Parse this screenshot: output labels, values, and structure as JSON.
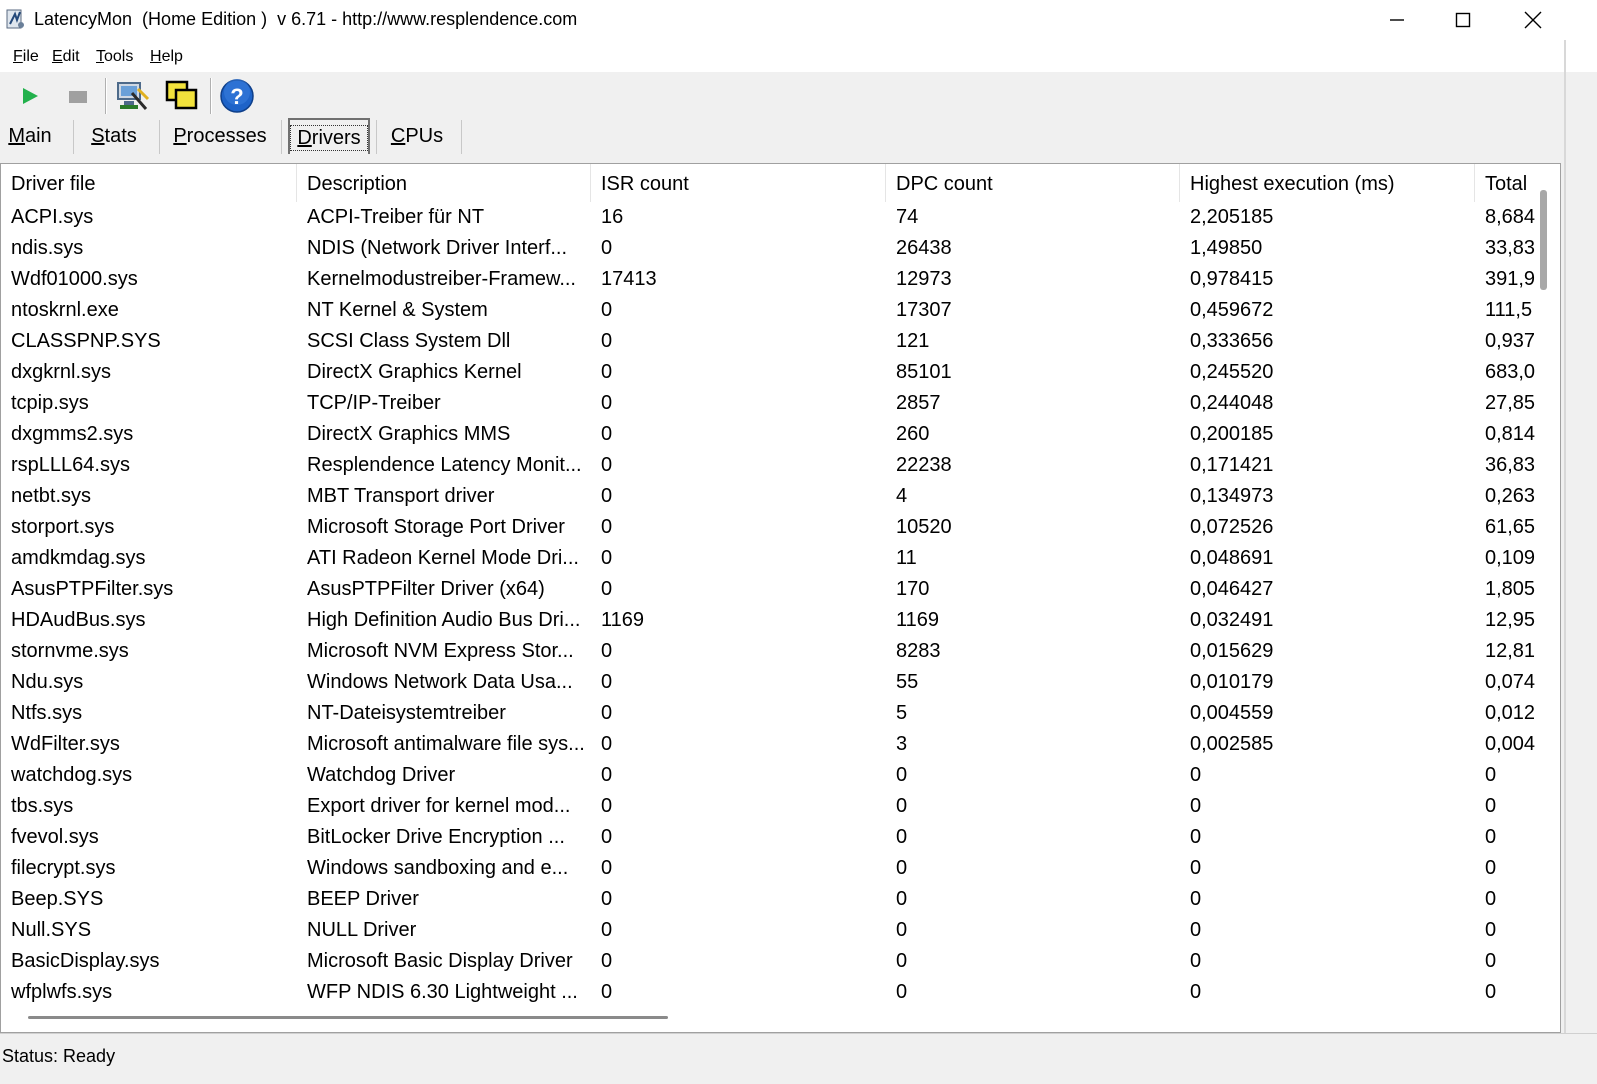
{
  "window": {
    "title": "LatencyMon  (Home Edition )  v 6.71 - http://www.resplendence.com",
    "controls": [
      "minimize-button",
      "maximize-button",
      "close-button"
    ]
  },
  "menu": [
    {
      "label": "File",
      "ul": "F",
      "rest": "ile"
    },
    {
      "label": "Edit",
      "ul": "E",
      "rest": "dit"
    },
    {
      "label": "Tools",
      "ul": "T",
      "rest": "ools"
    },
    {
      "label": "Help",
      "ul": "H",
      "rest": "elp"
    }
  ],
  "toolbar": {
    "buttons": [
      {
        "name": "start-monitoring-button",
        "icon": "play-icon",
        "color": "#22b14c"
      },
      {
        "name": "stop-monitoring-button",
        "icon": "stop-icon",
        "color": "#a0a0a0"
      },
      {
        "name": "system-info-button",
        "icon": "monitor-tools-icon"
      },
      {
        "name": "windows-button",
        "icon": "windows-icon"
      },
      {
        "name": "help-button",
        "icon": "help-icon",
        "color": "#1e63c8"
      }
    ]
  },
  "tabs": [
    {
      "label": "Main",
      "ul": "M",
      "rest": "ain",
      "active": false
    },
    {
      "label": "Stats",
      "ul": "S",
      "rest": "tats",
      "active": false
    },
    {
      "label": "Processes",
      "ul": "P",
      "rest": "rocesses",
      "active": false
    },
    {
      "label": "Drivers",
      "ul": "D",
      "rest": "rivers",
      "active": true
    },
    {
      "label": "CPUs",
      "ul": "C",
      "rest": "PUs",
      "active": false
    }
  ],
  "table": {
    "columns": [
      "Driver file",
      "Description",
      "ISR count",
      "DPC count",
      "Highest execution (ms)",
      "Total"
    ],
    "rows": [
      [
        "ACPI.sys",
        "ACPI-Treiber für NT",
        "16",
        "74",
        "2,205185",
        "8,684"
      ],
      [
        "ndis.sys",
        "NDIS (Network Driver Interf...",
        "0",
        "26438",
        "1,49850",
        "33,83"
      ],
      [
        "Wdf01000.sys",
        "Kernelmodustreiber-Framew...",
        "17413",
        "12973",
        "0,978415",
        "391,9"
      ],
      [
        "ntoskrnl.exe",
        "NT Kernel & System",
        "0",
        "17307",
        "0,459672",
        "111,5"
      ],
      [
        "CLASSPNP.SYS",
        "SCSI Class System Dll",
        "0",
        "121",
        "0,333656",
        "0,937"
      ],
      [
        "dxgkrnl.sys",
        "DirectX Graphics Kernel",
        "0",
        "85101",
        "0,245520",
        "683,0"
      ],
      [
        "tcpip.sys",
        "TCP/IP-Treiber",
        "0",
        "2857",
        "0,244048",
        "27,85"
      ],
      [
        "dxgmms2.sys",
        "DirectX Graphics MMS",
        "0",
        "260",
        "0,200185",
        "0,814"
      ],
      [
        "rspLLL64.sys",
        "Resplendence Latency Monit...",
        "0",
        "22238",
        "0,171421",
        "36,83"
      ],
      [
        "netbt.sys",
        "MBT Transport driver",
        "0",
        "4",
        "0,134973",
        "0,263"
      ],
      [
        "storport.sys",
        "Microsoft Storage Port Driver",
        "0",
        "10520",
        "0,072526",
        "61,65"
      ],
      [
        "amdkmdag.sys",
        "ATI Radeon Kernel Mode Dri...",
        "0",
        "11",
        "0,048691",
        "0,109"
      ],
      [
        "AsusPTPFilter.sys",
        "AsusPTPFilter Driver (x64)",
        "0",
        "170",
        "0,046427",
        "1,805"
      ],
      [
        "HDAudBus.sys",
        "High Definition Audio Bus Dri...",
        "1169",
        "1169",
        "0,032491",
        "12,95"
      ],
      [
        "stornvme.sys",
        "Microsoft NVM Express Stor...",
        "0",
        "8283",
        "0,015629",
        "12,81"
      ],
      [
        "Ndu.sys",
        "Windows Network Data Usa...",
        "0",
        "55",
        "0,010179",
        "0,074"
      ],
      [
        "Ntfs.sys",
        "NT-Dateisystemtreiber",
        "0",
        "5",
        "0,004559",
        "0,012"
      ],
      [
        "WdFilter.sys",
        "Microsoft antimalware file sys...",
        "0",
        "3",
        "0,002585",
        "0,004"
      ],
      [
        "watchdog.sys",
        "Watchdog Driver",
        "0",
        "0",
        "0",
        "0"
      ],
      [
        "tbs.sys",
        "Export driver for kernel mod...",
        "0",
        "0",
        "0",
        "0"
      ],
      [
        "fvevol.sys",
        "BitLocker Drive Encryption ...",
        "0",
        "0",
        "0",
        "0"
      ],
      [
        "filecrypt.sys",
        "Windows sandboxing and e...",
        "0",
        "0",
        "0",
        "0"
      ],
      [
        "Beep.SYS",
        "BEEP Driver",
        "0",
        "0",
        "0",
        "0"
      ],
      [
        "Null.SYS",
        "NULL Driver",
        "0",
        "0",
        "0",
        "0"
      ],
      [
        "BasicDisplay.sys",
        "Microsoft Basic Display Driver",
        "0",
        "0",
        "0",
        "0"
      ],
      [
        "wfplwfs.sys",
        "WFP NDIS 6.30 Lightweight ...",
        "0",
        "0",
        "0",
        "0"
      ]
    ]
  },
  "status": {
    "text": "Status: Ready"
  }
}
